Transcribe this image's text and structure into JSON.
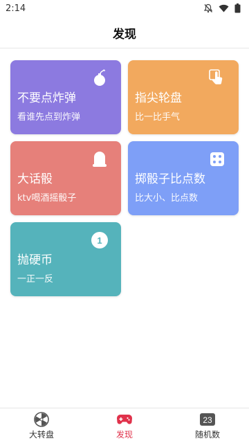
{
  "status_bar": {
    "time": "2:14"
  },
  "header": {
    "title": "发现"
  },
  "cards": [
    {
      "title": "不要点炸弹",
      "subtitle": "看谁先点到炸弹",
      "icon": "bomb-icon",
      "color": "#8c7ae0"
    },
    {
      "title": "指尖轮盘",
      "subtitle": "比一比手气",
      "icon": "finger-tap-icon",
      "color": "#f2a95e"
    },
    {
      "title": "大话骰",
      "subtitle": "ktv喝酒摇骰子",
      "icon": "dice-cup-icon",
      "color": "#e6807a"
    },
    {
      "title": "掷骰子比点数",
      "subtitle": "比大小、比点数",
      "icon": "dice-icon",
      "color": "#7e9ff7"
    },
    {
      "title": "抛硬币",
      "subtitle": "一正一反",
      "icon": "coin-icon",
      "coin_value": "1",
      "color": "#55b3bb"
    }
  ],
  "bottom_nav": {
    "items": [
      {
        "label": "大转盘",
        "icon": "wheel-icon",
        "active": false
      },
      {
        "label": "发现",
        "icon": "gamepad-icon",
        "active": true
      },
      {
        "label": "随机数",
        "icon": "number-icon",
        "badge": "23",
        "active": false
      }
    ],
    "active_color": "#e0324b"
  }
}
